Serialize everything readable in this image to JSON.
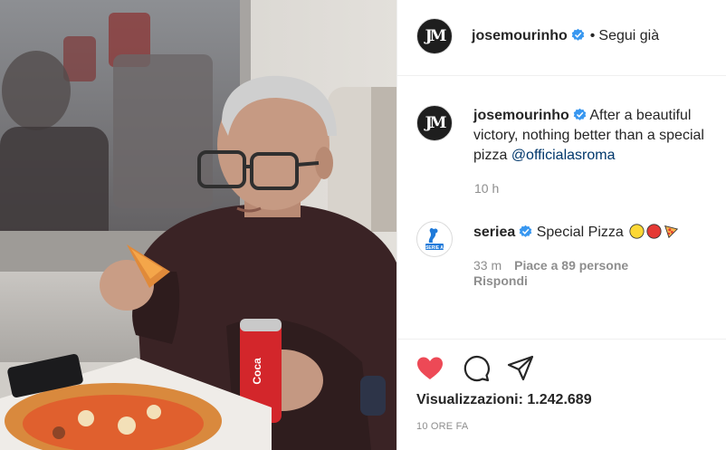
{
  "media": {
    "description": "video"
  },
  "header": {
    "username": "josemourinho",
    "separator": "•",
    "follow_label": "Segui già",
    "avatar_letters": "JM"
  },
  "caption": {
    "username": "josemourinho",
    "text": "After a beautiful victory, nothing better than a special pizza",
    "mention": "@officialasroma",
    "time": "10 h"
  },
  "comment": {
    "username": "seriea",
    "text": "Special Pizza",
    "time": "33 m",
    "likes": "Piace a 89 persone",
    "reply_label": "Rispondi"
  },
  "stats": {
    "views_label": "Visualizzazioni:",
    "views_value": "1.242.689",
    "posted_ago": "10 ORE FA"
  },
  "colors": {
    "verified_blue": "#3897f0",
    "like_red": "#ed4956",
    "mention_blue": "#00376b",
    "secondary_text": "#8e8e8e"
  }
}
